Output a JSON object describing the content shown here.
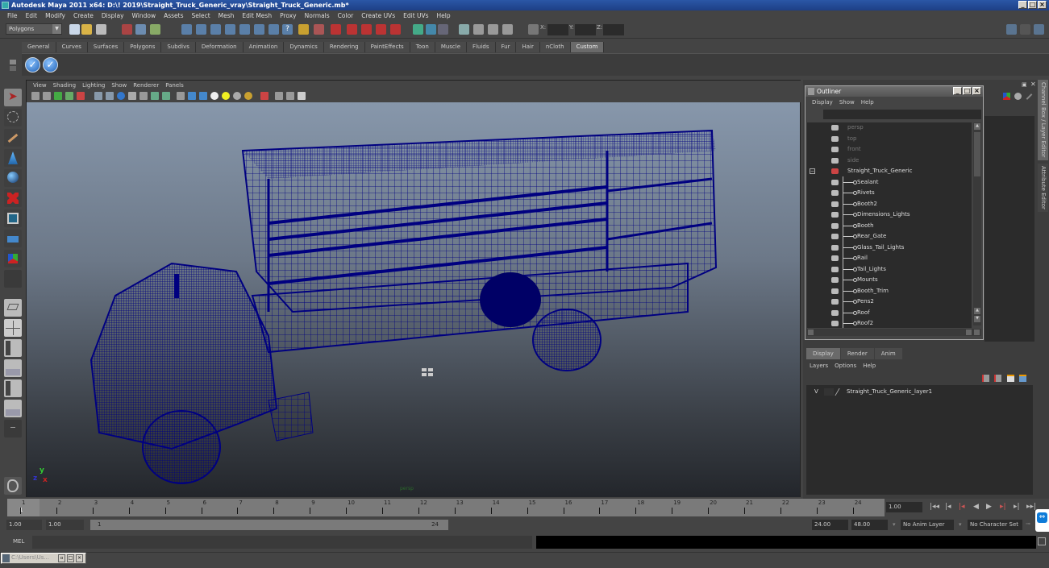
{
  "window": {
    "title": "Autodesk Maya 2011 x64: D:\\! 2019\\Straight_Truck_Generic_vray\\Straight_Truck_Generic.mb*",
    "controls": [
      "_",
      "□",
      "×"
    ]
  },
  "menubar": [
    "File",
    "Edit",
    "Modify",
    "Create",
    "Display",
    "Window",
    "Assets",
    "Select",
    "Mesh",
    "Edit Mesh",
    "Proxy",
    "Normals",
    "Color",
    "Create UVs",
    "Edit UVs",
    "Help"
  ],
  "toolbar": {
    "menuset": "Polygons",
    "coord_labels": {
      "x": "X:",
      "y": "Y:",
      "z": "Z:"
    },
    "coord_values": {
      "x": "",
      "y": "",
      "z": ""
    }
  },
  "shelf": {
    "tabs": [
      "General",
      "Curves",
      "Surfaces",
      "Polygons",
      "Subdivs",
      "Deformation",
      "Animation",
      "Dynamics",
      "Rendering",
      "PaintEffects",
      "Toon",
      "Muscle",
      "Fluids",
      "Fur",
      "Hair",
      "nCloth",
      "Custom"
    ],
    "active_tab": "Custom",
    "buttons": [
      "check-icon",
      "check-icon"
    ]
  },
  "viewport": {
    "menu": [
      "View",
      "Shading",
      "Lighting",
      "Show",
      "Renderer",
      "Panels"
    ],
    "camera_label": "persp",
    "axis": {
      "y": "y",
      "x": "x",
      "z": "z"
    },
    "wire_color": "#000080"
  },
  "outliner": {
    "title": "Outliner",
    "menu": [
      "Display",
      "Show",
      "Help"
    ],
    "cameras": [
      "persp",
      "top",
      "front",
      "side"
    ],
    "root": "Straight_Truck_Generic",
    "children": [
      "Sealant",
      "Rivets",
      "Booth2",
      "Dimensions_Lights",
      "Booth",
      "Rear_Gate",
      "Glass_Tail_Lights",
      "Rail",
      "Tail_Lights",
      "Mounts",
      "Booth_Trim",
      "Pens2",
      "Roof",
      "Roof2"
    ]
  },
  "layer_editor": {
    "tabs": [
      "Display",
      "Render",
      "Anim"
    ],
    "active_tab": "Display",
    "menu": [
      "Layers",
      "Options",
      "Help"
    ],
    "layers": [
      {
        "visible": "V",
        "name": "Straight_Truck_Generic_layer1"
      }
    ]
  },
  "side_tabs": [
    "Channel Box / Layer Editor",
    "Attribute Editor"
  ],
  "timeline": {
    "ticks": [
      "1",
      "2",
      "3",
      "4",
      "5",
      "6",
      "7",
      "8",
      "9",
      "10",
      "11",
      "12",
      "13",
      "14",
      "15",
      "16",
      "17",
      "18",
      "19",
      "20",
      "21",
      "22",
      "23",
      "24"
    ],
    "current_frame": "1",
    "current_time_field": "1.00"
  },
  "range": {
    "start_time": "1.00",
    "playback_start": "1.00",
    "range_start": "1",
    "range_end": "24",
    "playback_end": "24.00",
    "end_time": "48.00",
    "anim_layer": "No Anim Layer",
    "character_set": "No Character Set"
  },
  "command_line": {
    "label": "MEL",
    "input": "",
    "output": ""
  },
  "taskbar": {
    "item": "C:\\Users\\Us..."
  }
}
